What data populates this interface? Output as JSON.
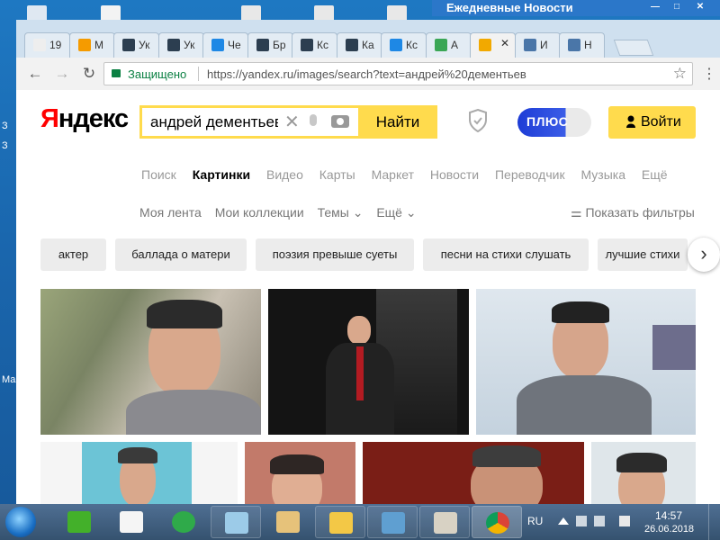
{
  "desktop": {
    "labels": {
      "left_3": "З",
      "left_4": "З",
      "left_ma": "Ма"
    },
    "news_widget": {
      "title": "Ежедневные Новости",
      "minimize": "—",
      "restore": "□",
      "close": "✕"
    }
  },
  "browser": {
    "tabs": [
      {
        "title": "19",
        "icon": "page-icon",
        "color": "#eeeeee"
      },
      {
        "title": "M",
        "icon": "ok-icon",
        "color": "#f59b00"
      },
      {
        "title": "Ук",
        "icon": "page-icon",
        "color": "#2c3e50"
      },
      {
        "title": "Ук",
        "icon": "page-icon",
        "color": "#2c3e50"
      },
      {
        "title": "Че",
        "icon": "globe-icon",
        "color": "#1e88e5"
      },
      {
        "title": "Бр",
        "icon": "page-icon",
        "color": "#2c3e50"
      },
      {
        "title": "Кс",
        "icon": "page-icon",
        "color": "#2c3e50"
      },
      {
        "title": "Ка",
        "icon": "page-icon",
        "color": "#2c3e50"
      },
      {
        "title": "Кс",
        "icon": "globe-icon",
        "color": "#1e88e5"
      },
      {
        "title": "А",
        "icon": "green-icon",
        "color": "#3aa655"
      },
      {
        "title": "",
        "icon": "image-icon",
        "color": "#f2a900",
        "active": true
      },
      {
        "title": "И",
        "icon": "vk-icon",
        "color": "#4a76a8"
      },
      {
        "title": "Н",
        "icon": "vk-icon",
        "color": "#4a76a8"
      }
    ],
    "tab_close": "✕",
    "nav": {
      "back": "←",
      "forward": "→",
      "reload": "↻"
    },
    "secure_label": "Защищено",
    "url": "https://yandex.ru/images/search?text=андрей%20дементьев",
    "star": "☆",
    "menu": "⋮"
  },
  "yandex": {
    "logo_first": "Я",
    "logo_rest": "ндекс",
    "search_query": "андрей дементьев",
    "clear": "✕",
    "search_button": "Найти",
    "plus_label": "ПЛЮС",
    "login_label": "Войти",
    "services": [
      "Поиск",
      "Картинки",
      "Видео",
      "Карты",
      "Маркет",
      "Новости",
      "Переводчик",
      "Музыка",
      "Ещё"
    ],
    "subnav": [
      "Моя лента",
      "Мои коллекции",
      "Темы ⌄",
      "Ещё ⌄"
    ],
    "filters_label": "⚌ Показать фильтры",
    "chips": [
      "актер",
      "баллада о матери",
      "поэзия превыше суеты",
      "песни на стихи слушать",
      "лучшие стихи"
    ],
    "chips_next": "›"
  },
  "taskbar": {
    "lang": "RU",
    "time": "14:57",
    "date": "26.06.2018"
  },
  "colors": {
    "yandex_yellow": "#ffdb4d",
    "yandex_red": "#ff0000",
    "secure_green": "#0b8043",
    "plus_blue": "#1d3cd6"
  }
}
